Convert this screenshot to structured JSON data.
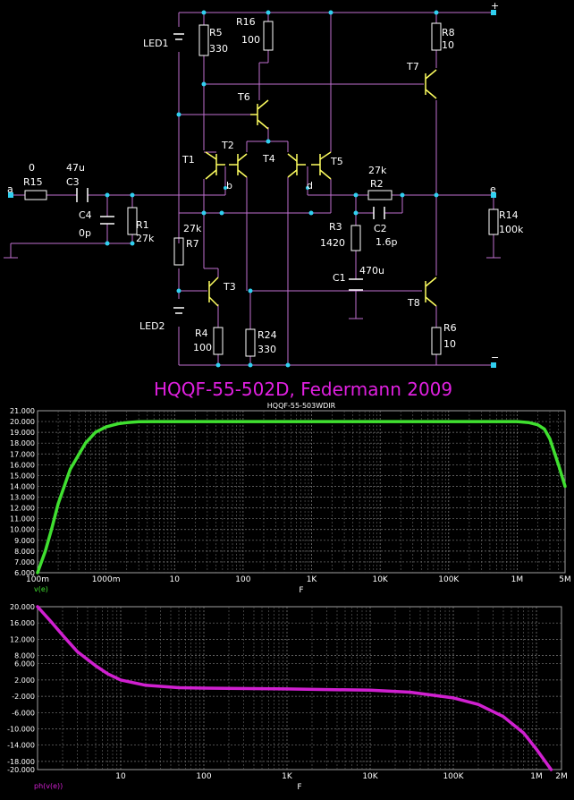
{
  "schematic": {
    "title": "HQQF-55-502D, Federmann 2009",
    "colors": {
      "wire": "#c070d0",
      "component": "#ffffff",
      "transistor": "#ffff60",
      "node": "#30d0f0",
      "title": "#e020e0"
    },
    "nodes": {
      "a": "a",
      "b": "b",
      "d": "d",
      "e": "e",
      "plus": "+",
      "minus": "−"
    },
    "labels": {
      "R15": "R15",
      "R15_val": "0",
      "C3": "C3",
      "C3_val": "47u",
      "C4": "C4",
      "C4_val": "0p",
      "R1": "R1",
      "R1_val": "27k",
      "LED1": "LED1",
      "LED2": "LED2",
      "R5": "R5",
      "R5_val": "330",
      "R16": "R16",
      "R16_val": "100",
      "R7": "R7",
      "R7_val": "27k",
      "R4": "R4",
      "R4_val": "100",
      "R24": "R24",
      "R24_val": "330",
      "R3": "R3",
      "R3_val": "1420",
      "R2": "R2",
      "R2_val": "27k",
      "C2": "C2",
      "C2_val": "1.6p",
      "C1": "C1",
      "C1_val": "470u",
      "R14": "R14",
      "R14_val": "100k",
      "R8": "R8",
      "R8_val": "10",
      "R6": "R6",
      "R6_val": "10",
      "T1": "T1",
      "T2": "T2",
      "T3": "T3",
      "T4": "T4",
      "T5": "T5",
      "T6": "T6",
      "T7": "T7",
      "T8": "T8"
    }
  },
  "chart_data": [
    {
      "type": "line",
      "title": "HQQF-55-503WDIR",
      "xlabel": "F",
      "ylabel": "v(e)",
      "x_scale": "log",
      "xlim": [
        0.1,
        5000000
      ],
      "ylim": [
        6,
        21
      ],
      "grid": true,
      "line_color": "#40e030",
      "x_ticks": [
        {
          "v": 0.1,
          "label": "100m"
        },
        {
          "v": 1,
          "label": "1000m"
        },
        {
          "v": 10,
          "label": "10"
        },
        {
          "v": 100,
          "label": "100"
        },
        {
          "v": 1000,
          "label": "1K"
        },
        {
          "v": 10000,
          "label": "10K"
        },
        {
          "v": 100000,
          "label": "100K"
        },
        {
          "v": 1000000,
          "label": "1M"
        },
        {
          "v": 5000000,
          "label": "5M"
        }
      ],
      "y_ticks": [
        "21.000",
        "20.000",
        "19.000",
        "18.000",
        "17.000",
        "16.000",
        "15.000",
        "14.000",
        "13.000",
        "12.000",
        "11.000",
        "10.000",
        "9.000",
        "8.000",
        "7.000",
        "6.000"
      ],
      "series": [
        {
          "name": "v(e)",
          "x": [
            0.1,
            0.13,
            0.16,
            0.2,
            0.3,
            0.5,
            0.7,
            1,
            1.5,
            2,
            3,
            5,
            10,
            100,
            1000,
            10000,
            100000,
            1000000,
            1500000,
            2000000,
            2500000,
            3000000,
            4000000,
            5000000
          ],
          "y": [
            6.0,
            8.0,
            10.0,
            12.4,
            15.6,
            18.0,
            19.0,
            19.5,
            19.8,
            19.9,
            19.98,
            20.0,
            20.0,
            20.0,
            20.0,
            20.0,
            20.0,
            20.0,
            19.9,
            19.7,
            19.3,
            18.4,
            16.0,
            14.0
          ]
        }
      ]
    },
    {
      "type": "line",
      "title": "",
      "xlabel": "F",
      "ylabel": "ph(v(e))",
      "x_scale": "log",
      "xlim": [
        1,
        2000000
      ],
      "ylim": [
        -20,
        20
      ],
      "grid": true,
      "line_color": "#d020d0",
      "x_ticks": [
        {
          "v": 10,
          "label": "10"
        },
        {
          "v": 100,
          "label": "100"
        },
        {
          "v": 1000,
          "label": "1K"
        },
        {
          "v": 10000,
          "label": "10K"
        },
        {
          "v": 100000,
          "label": "100K"
        },
        {
          "v": 1000000,
          "label": "1M"
        },
        {
          "v": 2000000,
          "label": "2M"
        }
      ],
      "y_ticks": [
        "20.000",
        "16.000",
        "12.000",
        "8.000",
        "6.000",
        "2.000",
        "-2.000",
        "-6.000",
        "-10.000",
        "-14.000",
        "-18.000",
        "-20.000"
      ],
      "y_tick_values": [
        20,
        16,
        12,
        8,
        6,
        2,
        -2,
        -6,
        -10,
        -14,
        -18,
        -20
      ],
      "series": [
        {
          "name": "ph(v(e))",
          "x": [
            1,
            1.5,
            2,
            3,
            5,
            7,
            10,
            20,
            50,
            100,
            1000,
            10000,
            30000,
            100000,
            200000,
            400000,
            700000,
            1000000,
            1500000
          ],
          "y": [
            20,
            16,
            13,
            9,
            5.5,
            3.5,
            2.0,
            0.7,
            0.1,
            0.0,
            -0.2,
            -0.5,
            -1.0,
            -2.4,
            -4.0,
            -7.0,
            -11.0,
            -15.0,
            -20.0
          ]
        }
      ]
    }
  ]
}
